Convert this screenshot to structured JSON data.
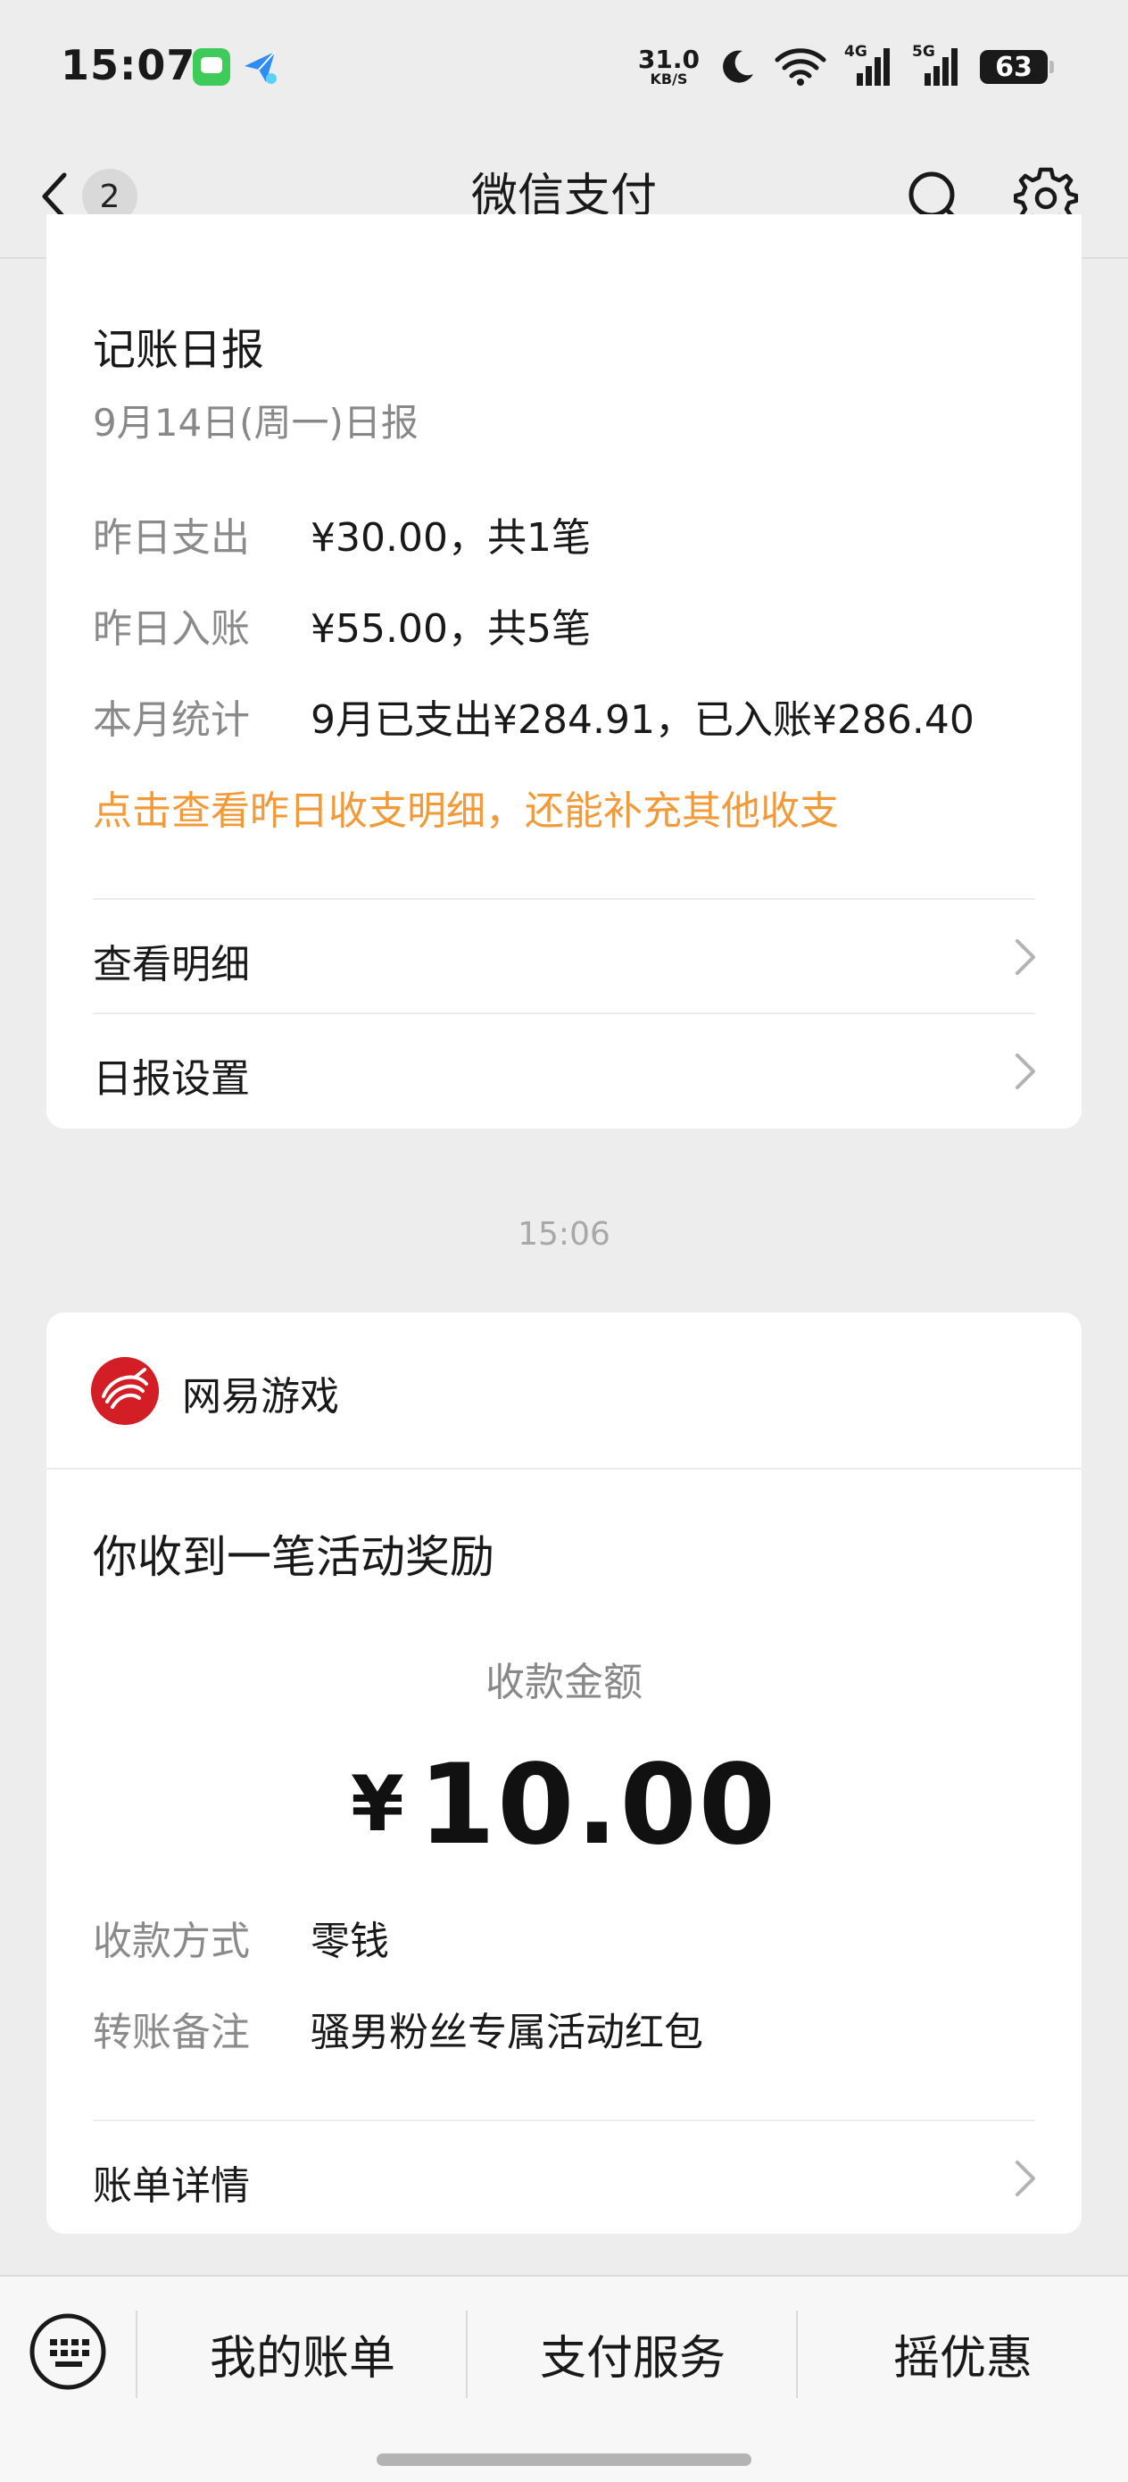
{
  "status_bar": {
    "time": "15:07",
    "net_speed_value": "31.0",
    "net_speed_unit": "KB/S",
    "signal_4g": "4G",
    "signal_5g": "5G",
    "battery": "63"
  },
  "nav": {
    "title": "微信支付",
    "unread_count": "2"
  },
  "daily_report": {
    "title": "记账日报",
    "subtitle": "9月14日(周一)日报",
    "rows": [
      {
        "label": "昨日支出",
        "value": "¥30.00，共1笔"
      },
      {
        "label": "昨日入账",
        "value": "¥55.00，共5笔"
      },
      {
        "label": "本月统计",
        "value": "9月已支出¥284.91，已入账¥286.40"
      }
    ],
    "hint_link": "点击查看昨日收支明细，还能补充其他收支",
    "links": [
      {
        "label": "查看明细"
      },
      {
        "label": "日报设置"
      }
    ]
  },
  "timestamp": "15:06",
  "reward": {
    "brand": "网易游戏",
    "title": "你收到一笔活动奖励",
    "amount_label": "收款金额",
    "currency": "¥",
    "amount": "10.00",
    "rows": [
      {
        "label": "收款方式",
        "value": "零钱"
      },
      {
        "label": "转账备注",
        "value": "骚男粉丝专属活动红包"
      }
    ],
    "detail_link": "账单详情"
  },
  "bottom_menu": {
    "items": [
      "我的账单",
      "支付服务",
      "摇优惠"
    ]
  },
  "colors": {
    "accent_orange": "#f29a38",
    "brand_red": "#d31e25",
    "background": "#ededed"
  }
}
